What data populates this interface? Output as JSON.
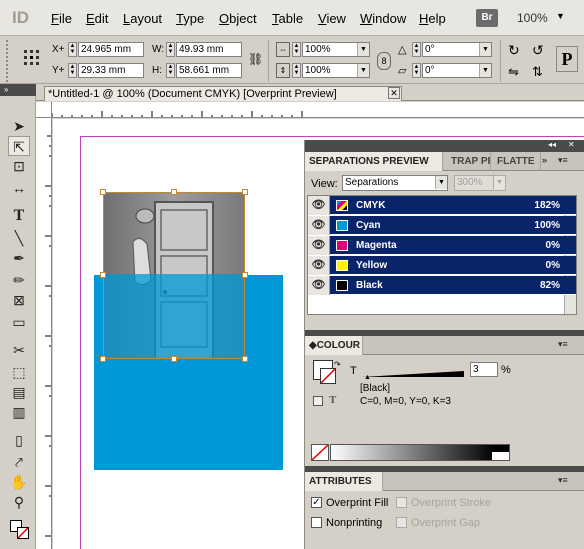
{
  "app": {
    "logo": "ID",
    "bridge_label": "Br",
    "zoom": "100%"
  },
  "menu": [
    "File",
    "Edit",
    "Layout",
    "Type",
    "Object",
    "Table",
    "View",
    "Window",
    "Help"
  ],
  "control": {
    "x_label": "X+",
    "x_value": "24.965 mm",
    "y_label": "Y+",
    "y_value": "29.33 mm",
    "w_label": "W:",
    "w_value": "49.93 mm",
    "h_label": "H:",
    "h_value": "58.661 mm",
    "scale_x": "100%",
    "scale_y": "100%",
    "rotate": "0°",
    "shear": "0°"
  },
  "document_tab": "*Untitled-1 @ 100% (Document CMYK) [Overprint Preview]",
  "separations": {
    "tabs": [
      "SEPARATIONS PREVIEW",
      "TRAP PR",
      "FLATTE"
    ],
    "view_label": "View:",
    "view_value": "Separations",
    "zoom_value": "300%",
    "rows": [
      {
        "name": "CMYK",
        "percent": "182%",
        "color": "#ffffff"
      },
      {
        "name": "Cyan",
        "percent": "100%",
        "color": "#0098d8"
      },
      {
        "name": "Magenta",
        "percent": "0%",
        "color": "#e0007a"
      },
      {
        "name": "Yellow",
        "percent": "0%",
        "color": "#fff200"
      },
      {
        "name": "Black",
        "percent": "82%",
        "color": "#000000"
      }
    ]
  },
  "colour": {
    "title": "COLOUR",
    "tint_label": "T",
    "tint_value": "3",
    "tint_unit": "%",
    "swatch_name": "[Black]",
    "values": "C=0, M=0, Y=0, K=3",
    "small_t": "T"
  },
  "attributes": {
    "title": "ATTRIBUTES",
    "overprint_fill": "Overprint Fill",
    "overprint_stroke": "Overprint Stroke",
    "nonprinting": "Nonprinting",
    "overprint_gap": "Overprint Gap",
    "overprint_fill_checked": true
  }
}
